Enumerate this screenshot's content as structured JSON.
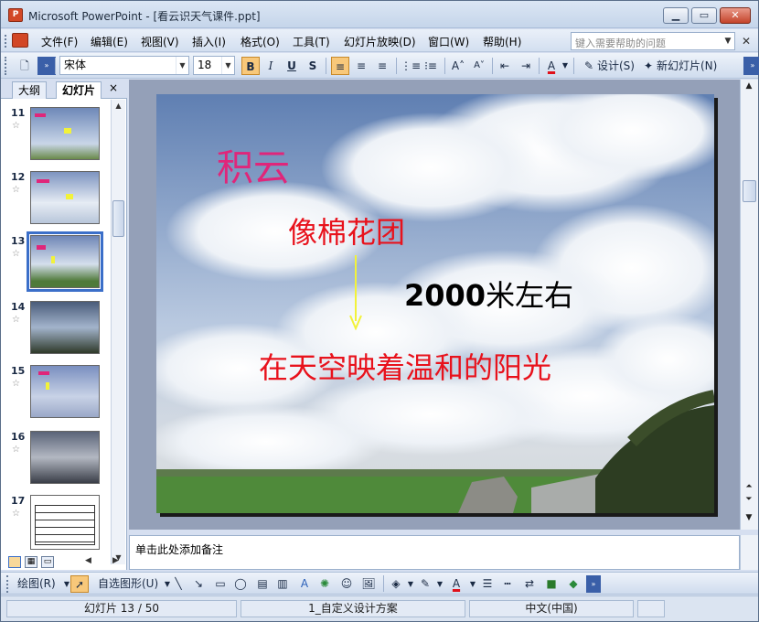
{
  "window": {
    "title": "Microsoft PowerPoint - [看云识天气课件.ppt]",
    "app_icon_text": "P"
  },
  "menu": {
    "items": [
      "文件(F)",
      "编辑(E)",
      "视图(V)",
      "插入(I)",
      "格式(O)",
      "工具(T)",
      "幻灯片放映(D)",
      "窗口(W)",
      "帮助(H)"
    ],
    "help_placeholder": "键入需要帮助的问题"
  },
  "toolbar": {
    "font_name": "宋体",
    "font_size": "18",
    "bold": "B",
    "italic": "I",
    "underline": "U",
    "shadow": "S",
    "design_label": "设计(S)",
    "new_slide_label": "新幻灯片(N)"
  },
  "panel": {
    "tab_outline": "大纲",
    "tab_slides": "幻灯片",
    "close": "×",
    "slides": [
      {
        "num": "11",
        "star": "☆"
      },
      {
        "num": "12",
        "star": "☆"
      },
      {
        "num": "13",
        "star": "☆"
      },
      {
        "num": "14",
        "star": "☆"
      },
      {
        "num": "15",
        "star": "☆"
      },
      {
        "num": "16",
        "star": "☆"
      },
      {
        "num": "17",
        "star": "☆"
      }
    ]
  },
  "slide": {
    "title": "积云",
    "line1": "像棉花团",
    "height": "2000米左右",
    "line2": "在天空映着温和的阳光",
    "title_color": "#e0267a",
    "text_color": "#e8121c",
    "arrow_color": "#f2f23a"
  },
  "notes": {
    "placeholder": "单击此处添加备注"
  },
  "drawing": {
    "draw_label": "绘图(R)",
    "autoshape_label": "自选图形(U)"
  },
  "status": {
    "slide_info": "幻灯片 13 / 50",
    "design": "1_自定义设计方案",
    "language": "中文(中国)"
  }
}
